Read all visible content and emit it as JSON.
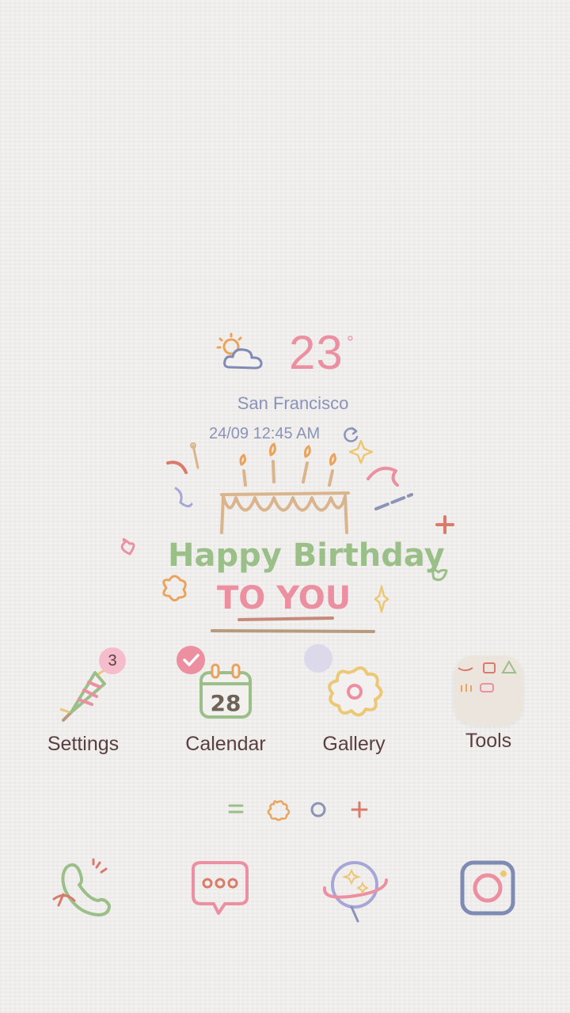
{
  "weather": {
    "temperature": "23",
    "unit": "°",
    "city": "San Francisco",
    "datetime": "24/09 12:45 AM",
    "icon": "partly-cloudy-icon"
  },
  "illustration": {
    "line1": "Happy Birthday",
    "line2": "TO YOU"
  },
  "apps": [
    {
      "label": "Settings",
      "icon": "party-popper-icon",
      "badge": "3"
    },
    {
      "label": "Calendar",
      "icon": "calendar-icon",
      "day": "28"
    },
    {
      "label": "Gallery",
      "icon": "flower-icon"
    },
    {
      "label": "Tools",
      "icon": "folder-icon"
    }
  ],
  "page_indicator": [
    "menu-icon",
    "flower-icon",
    "circle-icon",
    "plus-icon"
  ],
  "dock": [
    "phone-icon",
    "messages-icon",
    "browser-icon",
    "camera-icon"
  ],
  "colors": {
    "pink": "#ec8fa0",
    "blue_gray": "#8b93b8",
    "label_text": "#5a3f3f",
    "badge": "#f5bccc"
  }
}
